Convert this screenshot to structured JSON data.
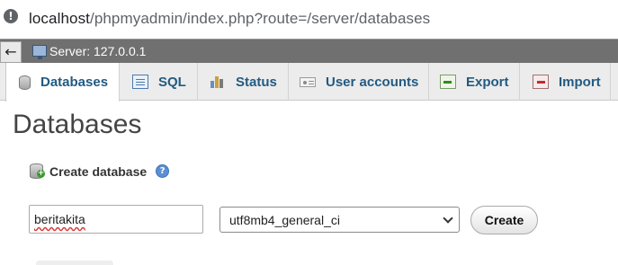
{
  "browser": {
    "url_host": "localhost",
    "url_path": "/phpmyadmin/index.php?route=/server/databases"
  },
  "breadcrumb": {
    "back_icon": "←",
    "server_label": "Server: 127.0.0.1"
  },
  "tabs": [
    {
      "label": "Databases",
      "icon": "database-icon",
      "active": true
    },
    {
      "label": "SQL",
      "icon": "sql-icon",
      "active": false
    },
    {
      "label": "Status",
      "icon": "status-chart-icon",
      "active": false
    },
    {
      "label": "User accounts",
      "icon": "user-accounts-icon",
      "active": false
    },
    {
      "label": "Export",
      "icon": "export-icon",
      "active": false
    },
    {
      "label": "Import",
      "icon": "import-icon",
      "active": false
    }
  ],
  "main": {
    "title": "Databases",
    "create_database_label": "Create database",
    "help_icon_glyph": "?",
    "db_name_value": "beritakita",
    "collation_selected": "utf8mb4_general_ci",
    "create_button_label": "Create"
  },
  "colors": {
    "tab_text": "#235a81",
    "server_bar": "#707070",
    "title_text": "#444444"
  }
}
